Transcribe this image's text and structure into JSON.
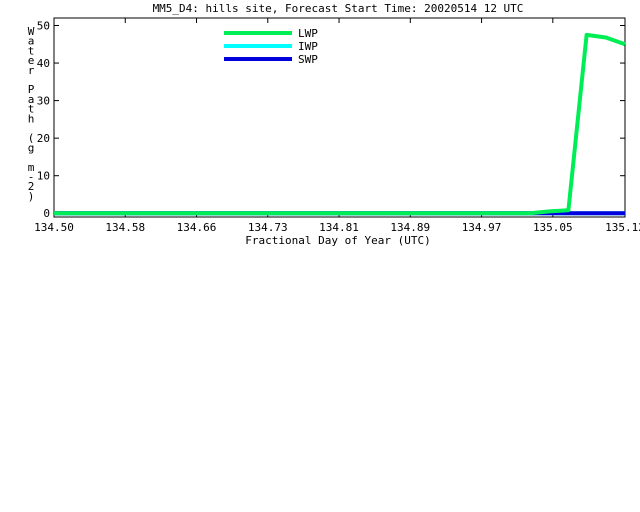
{
  "chart_data": {
    "type": "line",
    "title": "MM5_D4: hills site,  Forecast Start Time: 20020514 12 UTC",
    "xlabel": "Fractional Day of Year (UTC)",
    "ylabel": "Water Path (g m-2)",
    "ylabel_chars": [
      "W",
      "a",
      "t",
      "e",
      "r",
      "",
      "P",
      "a",
      "t",
      "h",
      "",
      "(",
      "g",
      "",
      "m",
      "-",
      "2",
      ")"
    ],
    "xlim": [
      134.5,
      135.125
    ],
    "ylim": [
      -1,
      52
    ],
    "x_ticks": [
      134.5,
      134.578,
      134.656,
      134.734,
      134.812,
      134.89,
      134.968,
      135.046,
      135.125
    ],
    "x_tick_labels": [
      "134.50",
      "134.58",
      "134.66",
      "134.73",
      "134.81",
      "134.89",
      "134.97",
      "135.05",
      "135.12"
    ],
    "y_ticks": [
      0,
      10,
      20,
      30,
      40,
      50
    ],
    "y_tick_labels": [
      "0",
      "10",
      "20",
      "30",
      "40",
      "50"
    ],
    "grid": false,
    "legend_position": "top-left",
    "series": [
      {
        "name": "LWP",
        "color": "#00ee55",
        "x": [
          134.5,
          134.958,
          134.979,
          135.0,
          135.021,
          135.042,
          135.063,
          135.083,
          135.104,
          135.125
        ],
        "y": [
          0,
          0,
          0,
          0,
          0,
          0.5,
          0.8,
          47.5,
          46.8,
          45.0
        ]
      },
      {
        "name": "IWP",
        "color": "#00ffff",
        "x": [
          134.5,
          135.125
        ],
        "y": [
          0,
          0
        ]
      },
      {
        "name": "SWP",
        "color": "#0000dd",
        "x": [
          134.5,
          135.125
        ],
        "y": [
          0,
          0
        ]
      }
    ]
  }
}
